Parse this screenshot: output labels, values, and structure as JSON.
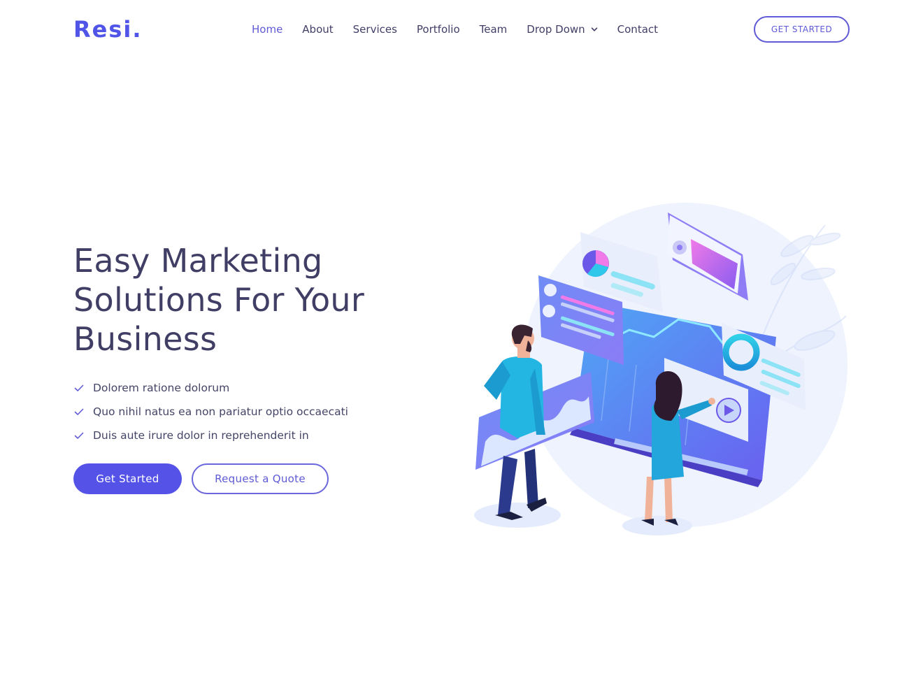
{
  "brand": {
    "logo_text": "Resi.",
    "accent": "#5055e8"
  },
  "nav": {
    "items": [
      {
        "label": "Home",
        "active": true
      },
      {
        "label": "About"
      },
      {
        "label": "Services"
      },
      {
        "label": "Portfolio"
      },
      {
        "label": "Team"
      },
      {
        "label": "Drop Down",
        "icon": "chevron-down-icon"
      },
      {
        "label": "Contact"
      }
    ]
  },
  "header_cta": {
    "label": "GET STARTED"
  },
  "hero": {
    "title_line_1": "Easy Marketing",
    "title_line_2": "Solutions For Your",
    "title_line_3": "Business",
    "features": [
      "Dolorem ratione dolorum",
      "Quo nihil natus ea non pariatur optio occaecati",
      "Duis aute irure dolor in reprehenderit in"
    ],
    "primary_button": "Get Started",
    "secondary_button": "Request a Quote"
  }
}
